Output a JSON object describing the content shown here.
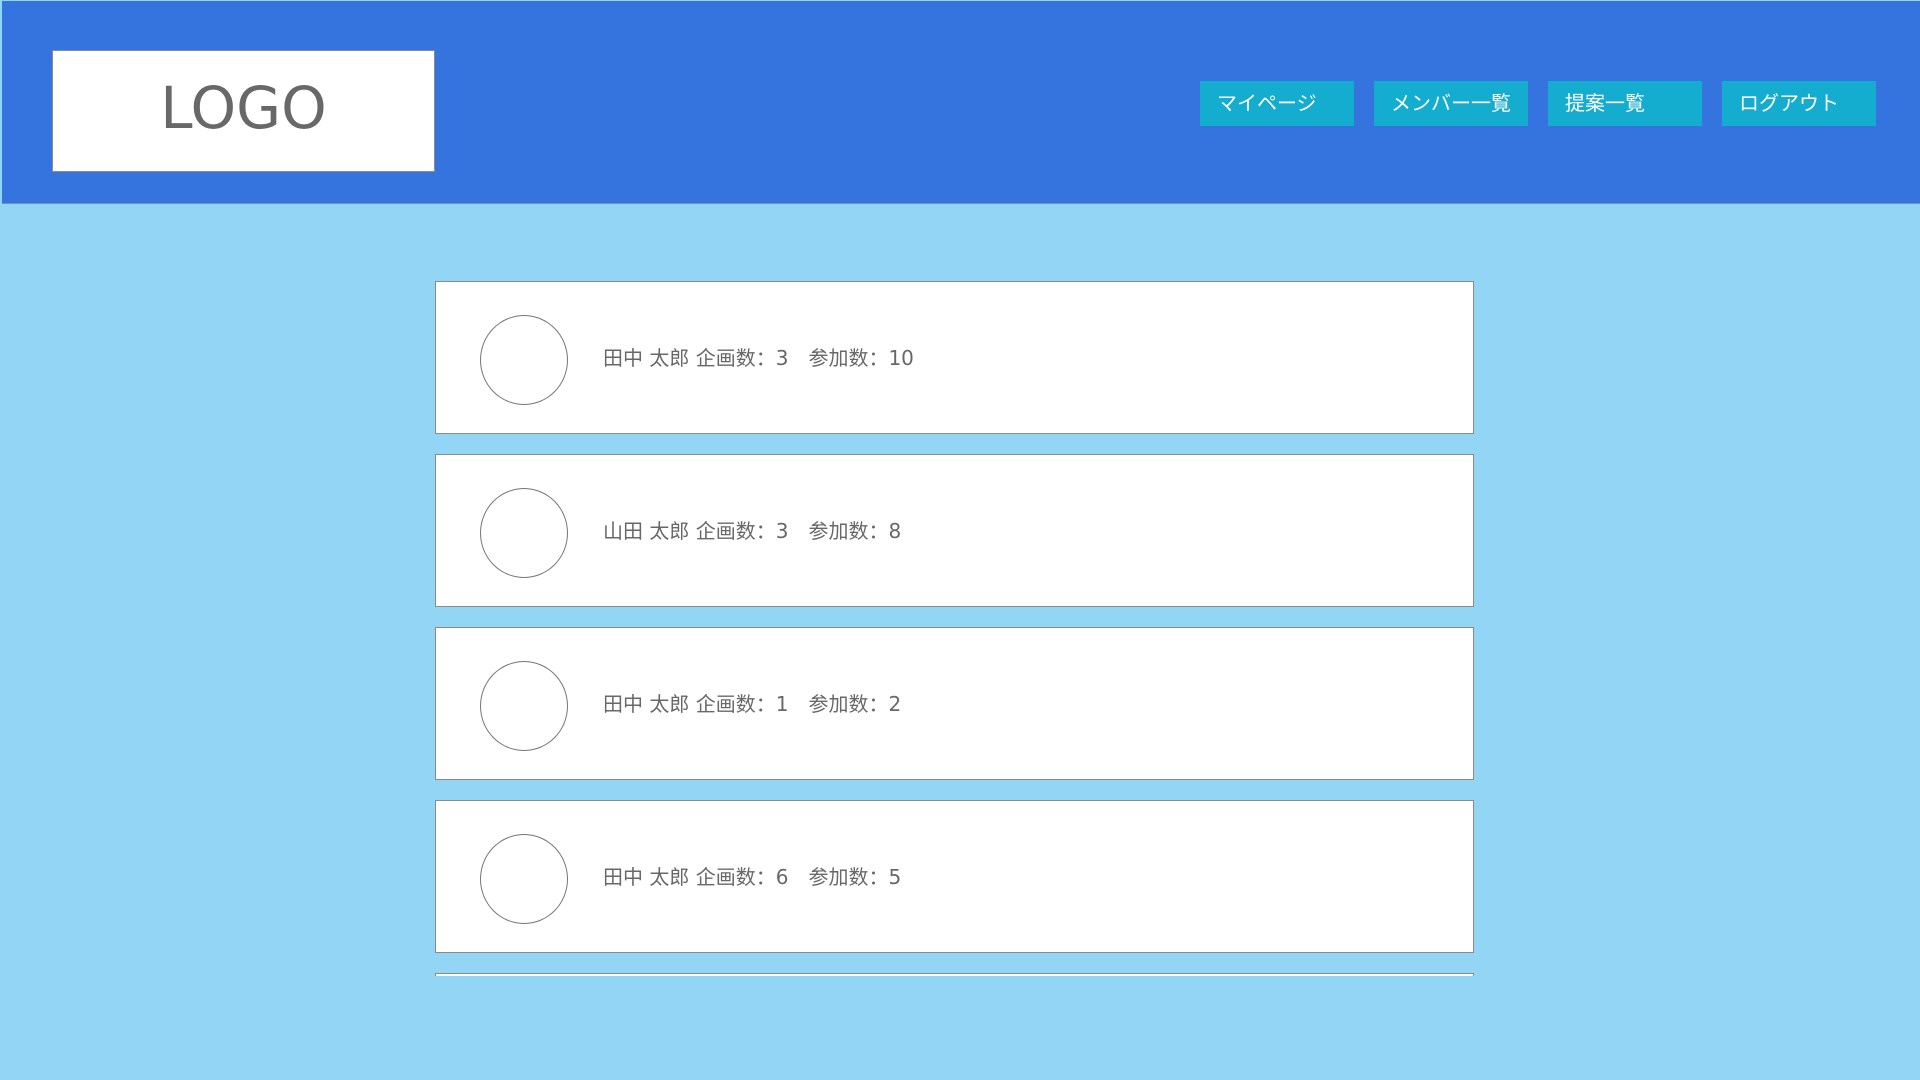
{
  "header": {
    "logo_text": "LOGO",
    "colors": {
      "header_background": "#3574df",
      "page_background": "#92d5f4",
      "nav_button": "#14adcf",
      "card_background": "#ffffff",
      "text": "#686868"
    },
    "nav": [
      {
        "label": "マイページ"
      },
      {
        "label": "メンバー一覧"
      },
      {
        "label": "提案一覧"
      },
      {
        "label": "ログアウト"
      }
    ]
  },
  "members": [
    {
      "info": "田中 太郎 企画数：3　参加数：10",
      "avatar_icon": "empty-circle-avatar"
    },
    {
      "info": "山田 太郎 企画数：3　参加数：8",
      "avatar_icon": "empty-circle-avatar"
    },
    {
      "info": "田中 太郎 企画数：1　参加数：2",
      "avatar_icon": "empty-circle-avatar"
    },
    {
      "info": "田中 太郎 企画数：6　参加数：5",
      "avatar_icon": "empty-circle-avatar"
    }
  ]
}
